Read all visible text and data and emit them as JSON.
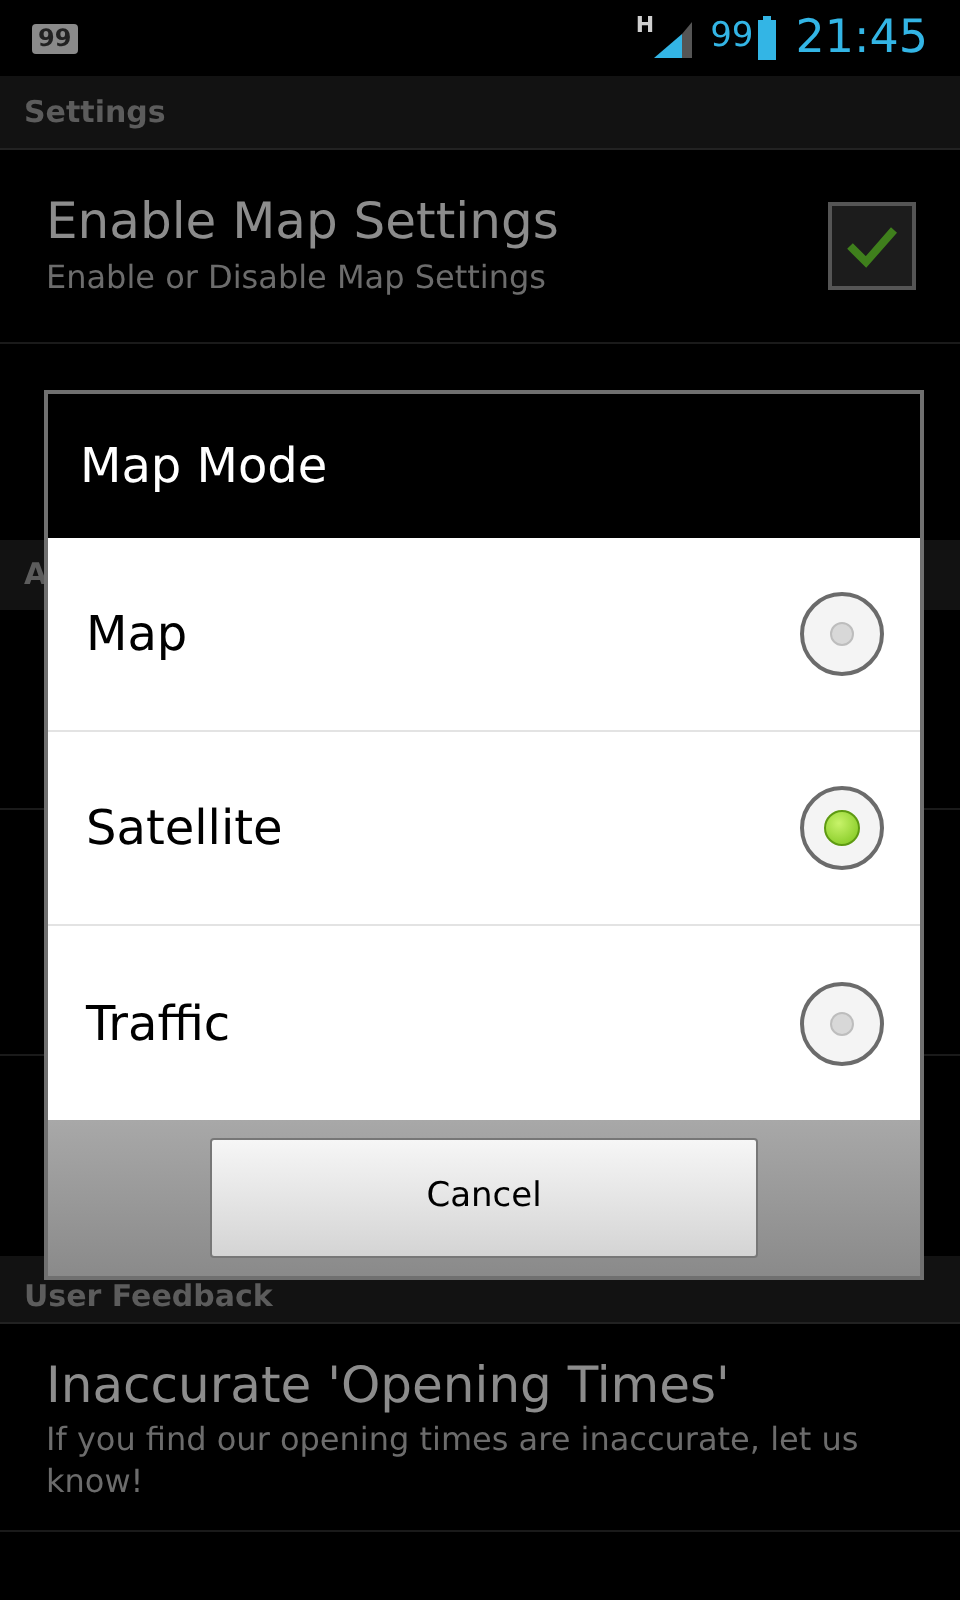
{
  "status_bar": {
    "notification_badge": "99",
    "network": "H",
    "battery": "99",
    "time": "21:45"
  },
  "settings": {
    "header": "Settings",
    "title": "Enable Map Settings",
    "subtitle": "Enable or Disable Map Settings",
    "checked": true
  },
  "hidden_section": {
    "header": "A"
  },
  "feedback": {
    "header": "User Feedback",
    "title": "Inaccurate 'Opening Times'",
    "subtitle": "If you find our opening times are inaccurate, let us know!"
  },
  "dialog": {
    "title": "Map Mode",
    "options": [
      {
        "label": "Map",
        "selected": false
      },
      {
        "label": "Satellite",
        "selected": true
      },
      {
        "label": "Traffic",
        "selected": false
      }
    ],
    "cancel": "Cancel"
  }
}
